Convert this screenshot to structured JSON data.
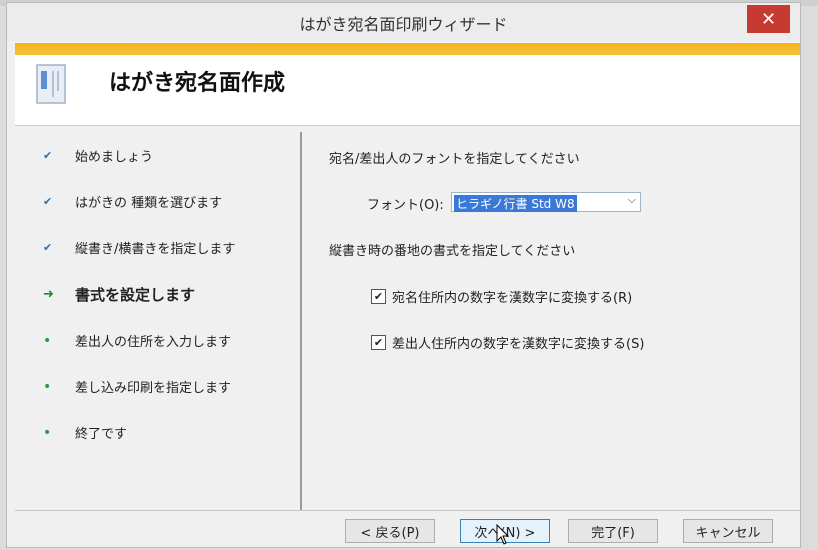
{
  "window": {
    "title": "はがき宛名面印刷ウィザード",
    "close_label": "✕"
  },
  "header": {
    "title": "はがき宛名面作成"
  },
  "steps": [
    {
      "label": "始めましょう",
      "state": "done"
    },
    {
      "label": "はがきの 種類を選びます",
      "state": "done"
    },
    {
      "label": "縦書き/横書きを指定します",
      "state": "done"
    },
    {
      "label": "書式を設定します",
      "state": "current"
    },
    {
      "label": "差出人の住所を入力します",
      "state": "pending"
    },
    {
      "label": "差し込み印刷を指定します",
      "state": "pending"
    },
    {
      "label": "終了です",
      "state": "pending"
    }
  ],
  "font_section": {
    "heading": "宛名/差出人のフォントを指定してください",
    "font_label": "フォント(O):",
    "font_value": "ヒラギノ行書 Std W8"
  },
  "address_section": {
    "heading": "縦書き時の番地の書式を指定してください",
    "options": [
      {
        "label": "宛名住所内の数字を漢数字に変換する(R)",
        "checked": true
      },
      {
        "label": "差出人住所内の数字を漢数字に変換する(S)",
        "checked": true
      }
    ]
  },
  "buttons": {
    "back": "< 戻る(P)",
    "next": "次へ(N) >",
    "finish": "完了(F)",
    "cancel": "キャンセル"
  },
  "icons": {
    "check": "check-icon",
    "arrow": "arrow-right-icon",
    "dot": "bullet-icon"
  },
  "colors": {
    "accent": "#f4b21a",
    "close": "#c73a31",
    "selection": "#3b79d8"
  }
}
